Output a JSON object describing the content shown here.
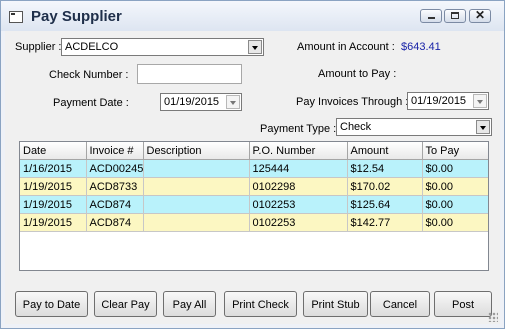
{
  "window": {
    "title": "Pay Supplier",
    "close_glyph": "✕"
  },
  "form": {
    "supplier_label": "Supplier :",
    "supplier_value": "ACDELCO",
    "amount_in_account_label": "Amount in Account :",
    "amount_in_account_value": "$643.41",
    "check_number_label": "Check Number :",
    "check_number_value": "",
    "amount_to_pay_label": "Amount to Pay :",
    "payment_date_label": "Payment Date :",
    "payment_date_value": "01/19/2015",
    "pay_invoices_through_label": "Pay Invoices Through :",
    "pay_invoices_through_value": "01/19/2015",
    "payment_type_label": "Payment Type :",
    "payment_type_value": "Check"
  },
  "grid": {
    "columns": [
      "Date",
      "Invoice #",
      "Description",
      "P.O. Number",
      "Amount",
      "To Pay"
    ],
    "rows": [
      [
        "1/16/2015",
        "ACD00245",
        "",
        "125444",
        "$12.54",
        "$0.00"
      ],
      [
        "1/19/2015",
        "ACD8733",
        "",
        "0102298",
        "$170.02",
        "$0.00"
      ],
      [
        "1/19/2015",
        "ACD874",
        "",
        "0102253",
        "$125.64",
        "$0.00"
      ],
      [
        "1/19/2015",
        "ACD874",
        "",
        "0102253",
        "$142.77",
        "$0.00"
      ]
    ]
  },
  "buttons": {
    "pay_to_date": "Pay to Date",
    "clear_pay": "Clear Pay",
    "pay_all": "Pay All",
    "print_check": "Print Check",
    "print_stub": "Print Stub",
    "cancel": "Cancel",
    "post": "Post"
  },
  "colors": {
    "row_even": "#b9f2fb",
    "row_odd": "#fcf7c2",
    "amount_blue": "#1a24a8"
  }
}
